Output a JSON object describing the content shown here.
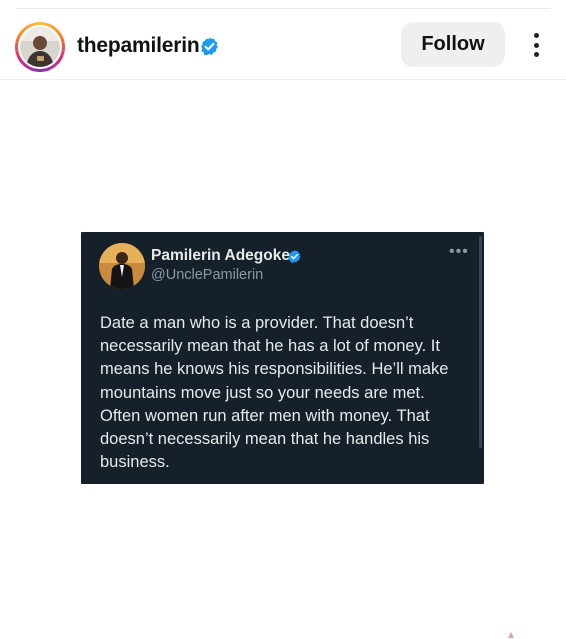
{
  "post_header": {
    "username": "thepamilerin",
    "verified_icon": "verified-badge-icon",
    "follow_label": "Follow",
    "more_icon": "more-vertical-icon"
  },
  "tweet": {
    "display_name": "Pamilerin Adegoke",
    "handle": "@UnclePamilerin",
    "more_icon": "more-horizontal-icon",
    "text_lines": [
      "Date a man who is a provider. That doesn’t",
      "necessarily mean that he has a lot of money. It",
      "means he knows his responsibilities. He’ll make",
      "mountains move just so your needs are met.",
      "Often women run after men with money. That",
      "doesn’t necessarily mean that he handles his",
      "business."
    ]
  },
  "colors": {
    "tweet_background": "#15202b",
    "tweet_text": "#e7e9ea",
    "tweet_secondary": "#8b98a5",
    "verified_blue": "#1d9bf0",
    "follow_button_bg": "#efefef"
  }
}
